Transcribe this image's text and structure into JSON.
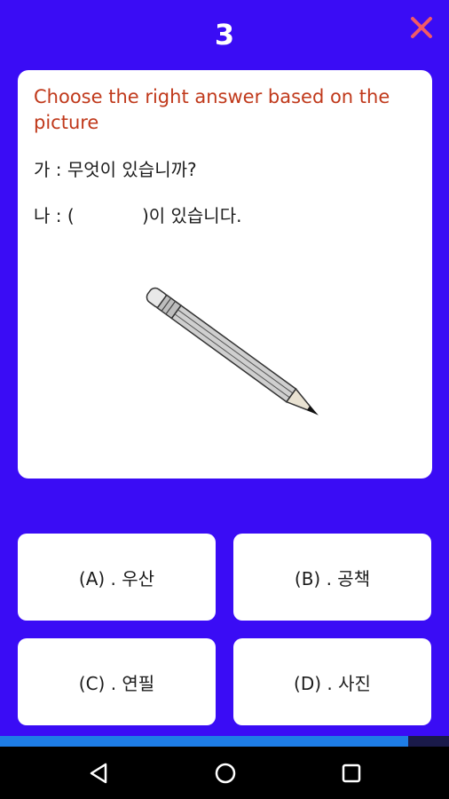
{
  "header": {
    "question_number": "3",
    "close_icon": "close-icon",
    "close_color": "#f05a66"
  },
  "question": {
    "prompt": "Choose the right answer based on the picture",
    "line1": "가 : 무엇이 있습니까?",
    "line2": "나 : (            )이 있습니다.",
    "image": "pencil-illustration"
  },
  "answers": [
    {
      "label": "(A) . 우산"
    },
    {
      "label": "(B) . 공책"
    },
    {
      "label": "(C) . 연필"
    },
    {
      "label": "(D) . 사진"
    }
  ],
  "progress": {
    "fraction": 0.91,
    "fill_color": "#1e7de6"
  },
  "colors": {
    "background": "#3a0cf5",
    "prompt_text": "#c0391b"
  },
  "navbar": {
    "icons": [
      "back-icon",
      "home-icon",
      "recent-apps-icon"
    ]
  }
}
